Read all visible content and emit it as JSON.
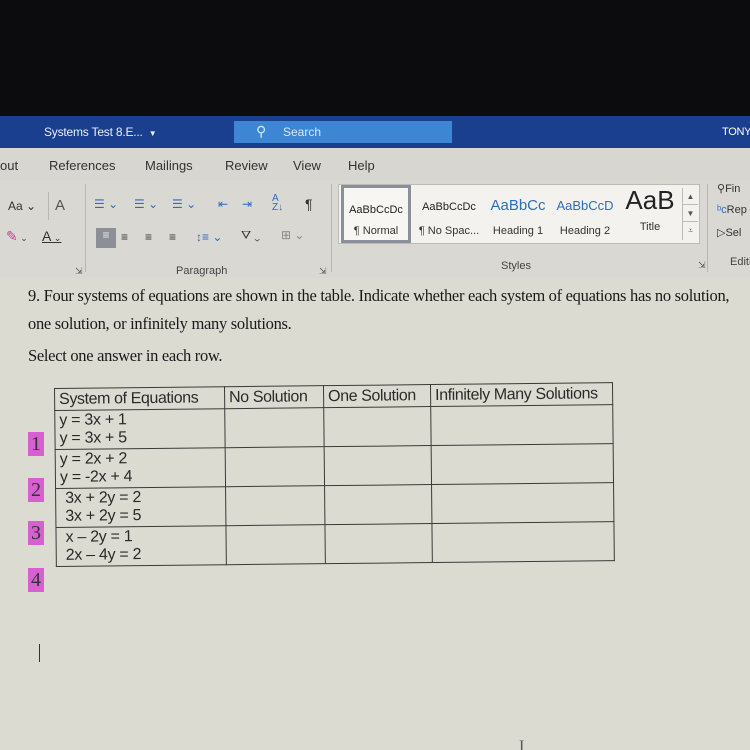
{
  "window": {
    "document_title": "Systems Test 8.E...",
    "search_placeholder": "Search",
    "user": "TONYA"
  },
  "ribbon_tabs": [
    "out",
    "References",
    "Mailings",
    "Review",
    "View",
    "Help"
  ],
  "ribbon": {
    "font_group": {
      "change_case": "Aa",
      "clear_formatting_icon": "A",
      "highlight_icon": "pen",
      "font_color_icon": "A"
    },
    "paragraph_group": {
      "label": "Paragraph",
      "pilcrow": "¶",
      "sort": "A↓Z"
    },
    "styles_group": {
      "label": "Styles",
      "items": [
        {
          "preview": "AaBbCcDc",
          "name": "¶ Normal",
          "selected": true
        },
        {
          "preview": "AaBbCcDc",
          "name": "¶ No Spac...",
          "selected": false
        },
        {
          "preview": "AaBbCc",
          "name": "Heading 1",
          "selected": false
        },
        {
          "preview": "AaBbCcD",
          "name": "Heading 2",
          "selected": false
        },
        {
          "preview": "AaB",
          "name": "Title",
          "selected": false
        }
      ]
    },
    "editing_group": {
      "label": "Editi",
      "find": "Fin",
      "replace": "Rep",
      "select": "Sel"
    }
  },
  "document": {
    "question": "9. Four systems of equations are shown in the table. Indicate whether each system of equations has no solution, one solution, or infinitely many solutions.",
    "instruction": "Select one answer in each row.",
    "table": {
      "headers": [
        "System of Equations",
        "No Solution",
        "One Solution",
        "Infinitely Many Solutions"
      ],
      "rows": [
        {
          "number": "1",
          "eq1": "y = 3x + 1",
          "eq2": "y = 3x + 5"
        },
        {
          "number": "2",
          "eq1": "y = 2x + 2",
          "eq2": "y = -2x + 4"
        },
        {
          "number": "3",
          "eq1": "3x + 2y = 2",
          "eq2": "3x + 2y = 5"
        },
        {
          "number": "4",
          "eq1": "x – 2y = 1",
          "eq2": "2x – 4y = 2"
        }
      ]
    }
  },
  "colors": {
    "title_bar": "#1b3f8f",
    "search_box": "#3c86d3",
    "row_number_highlight": "#d660d0"
  }
}
